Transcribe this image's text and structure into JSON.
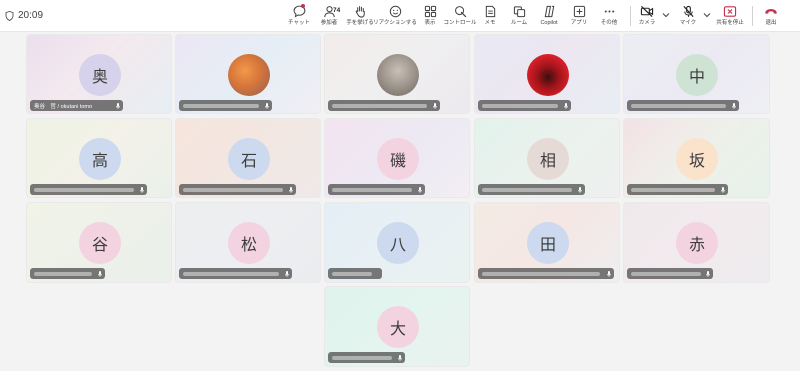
{
  "header": {
    "timer": "20:09",
    "participant_count": "74",
    "buttons": [
      {
        "key": "chat",
        "label": "チャット",
        "icon": "chat-icon"
      },
      {
        "key": "people",
        "label": "参加者",
        "icon": "people-icon"
      },
      {
        "key": "raise",
        "label": "手を挙げる",
        "icon": "raise-hand-icon"
      },
      {
        "key": "react",
        "label": "リアクションする",
        "icon": "smiley-icon"
      },
      {
        "key": "view",
        "label": "表示",
        "icon": "grid-view-icon"
      },
      {
        "key": "control",
        "label": "コントロール",
        "icon": "control-icon"
      },
      {
        "key": "notes",
        "label": "メモ",
        "icon": "notes-icon"
      },
      {
        "key": "rooms",
        "label": "ルーム",
        "icon": "rooms-icon"
      },
      {
        "key": "copilot",
        "label": "Copilot",
        "icon": "copilot-icon"
      },
      {
        "key": "apps",
        "label": "アプリ",
        "icon": "apps-icon"
      },
      {
        "key": "more",
        "label": "その他",
        "icon": "more-icon"
      },
      {
        "key": "camera",
        "label": "カメラ",
        "icon": "camera-off-icon"
      },
      {
        "key": "mic",
        "label": "マイク",
        "icon": "mic-off-icon"
      },
      {
        "key": "share",
        "label": "共有を停止",
        "icon": "share-stop-icon"
      },
      {
        "key": "leave",
        "label": "退出",
        "icon": "phone-hangup-icon"
      }
    ]
  },
  "tiles": [
    {
      "initial": "奥",
      "name": "奥谷　哲 / okutani tomo"
    },
    {
      "initial": "",
      "name": ""
    },
    {
      "initial": "",
      "name": ""
    },
    {
      "initial": "",
      "name": ""
    },
    {
      "initial": "中",
      "name": ""
    },
    {
      "initial": "高",
      "name": ""
    },
    {
      "initial": "石",
      "name": ""
    },
    {
      "initial": "磯",
      "name": ""
    },
    {
      "initial": "相",
      "name": ""
    },
    {
      "initial": "坂",
      "name": ""
    },
    {
      "initial": "谷",
      "name": ""
    },
    {
      "initial": "松",
      "name": ""
    },
    {
      "initial": "八",
      "name": ""
    },
    {
      "initial": "田",
      "name": ""
    },
    {
      "initial": "赤",
      "name": ""
    },
    {
      "initial": "大",
      "name": ""
    }
  ],
  "colors": {
    "avatar_purple": "#d6d2ec",
    "avatar_green": "#cfe3d4",
    "avatar_blue": "#cdd9ee",
    "avatar_pink": "#f3d3df",
    "avatar_peach": "#fbe2cb",
    "avatar_taupe": "#e6dad6",
    "leave_red": "#c4314b"
  }
}
